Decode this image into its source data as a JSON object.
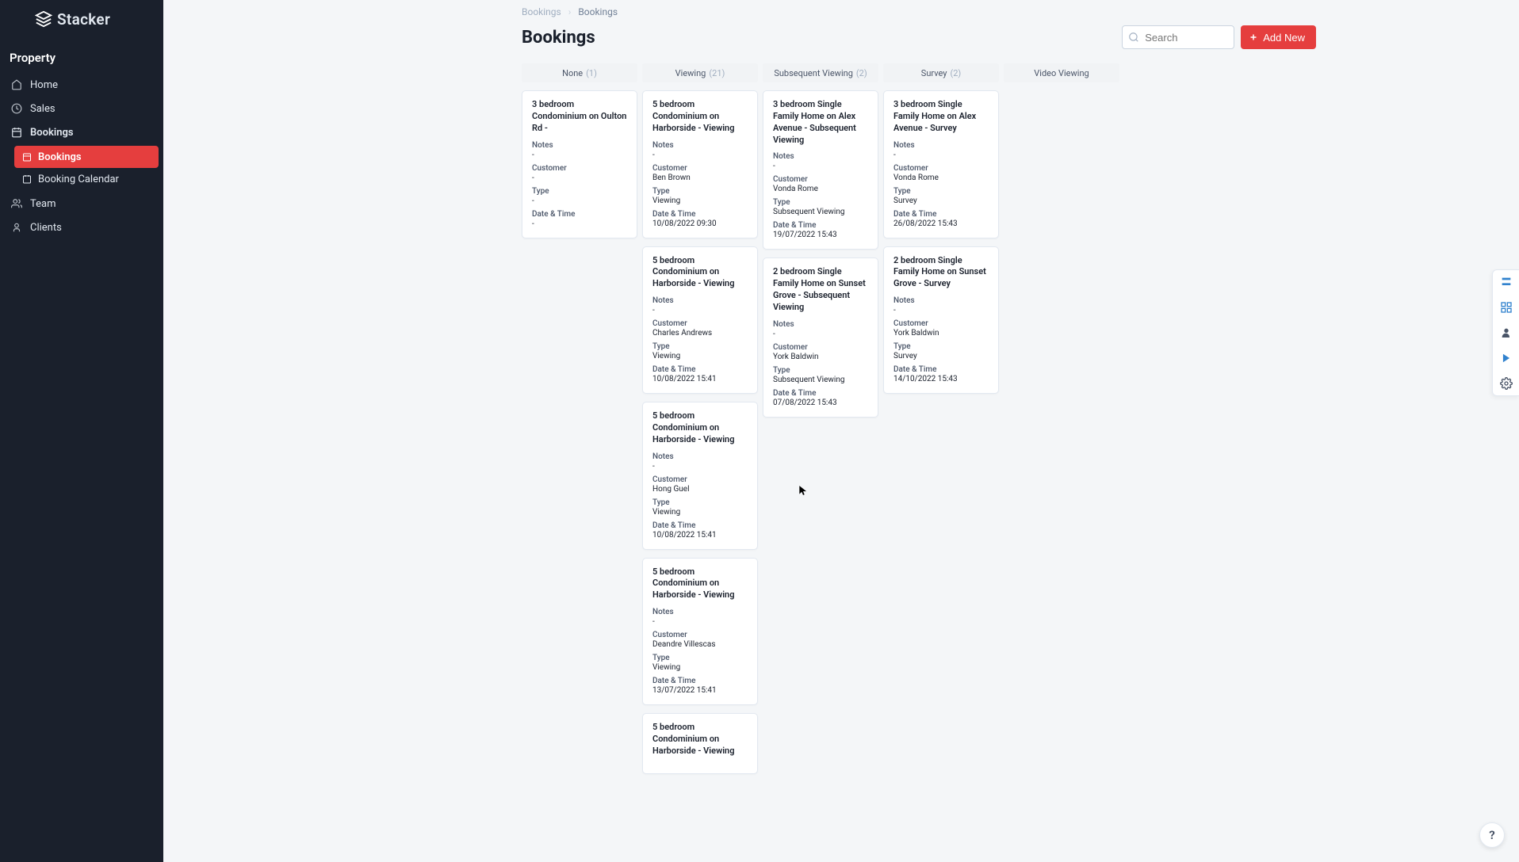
{
  "brand": {
    "name": "Stacker"
  },
  "sidebar": {
    "section": "Property",
    "items": [
      {
        "label": "Home"
      },
      {
        "label": "Sales"
      },
      {
        "label": "Bookings"
      },
      {
        "label": "Team"
      },
      {
        "label": "Clients"
      }
    ],
    "sub": [
      {
        "label": "Bookings"
      },
      {
        "label": "Booking Calendar"
      }
    ]
  },
  "crumbs": {
    "parent": "Bookings",
    "current": "Bookings"
  },
  "page_title": "Bookings",
  "search": {
    "placeholder": "Search"
  },
  "add_btn": {
    "label": "Add New"
  },
  "columns": [
    {
      "name": "None",
      "count": "(1)"
    },
    {
      "name": "Viewing",
      "count": "(21)"
    },
    {
      "name": "Subsequent Viewing",
      "count": "(2)"
    },
    {
      "name": "Survey",
      "count": "(2)"
    },
    {
      "name": "Video Viewing",
      "count": ""
    }
  ],
  "field_labels": {
    "notes": "Notes",
    "customer": "Customer",
    "type": "Type",
    "datetime": "Date & Time"
  },
  "cards": {
    "none": [
      {
        "title": "3 bedroom Condominium on Oulton Rd -",
        "notes": "-",
        "customer": "-",
        "type": "-",
        "datetime": "-"
      }
    ],
    "viewing": [
      {
        "title": "5 bedroom Condominium on Harborside - Viewing",
        "notes": "-",
        "customer": "Ben Brown",
        "type": "Viewing",
        "datetime": "10/08/2022 09:30"
      },
      {
        "title": "5 bedroom Condominium on Harborside - Viewing",
        "notes": "-",
        "customer": "Charles Andrews",
        "type": "Viewing",
        "datetime": "10/08/2022 15:41"
      },
      {
        "title": "5 bedroom Condominium on Harborside - Viewing",
        "notes": "-",
        "customer": "Hong Guel",
        "type": "Viewing",
        "datetime": "10/08/2022 15:41"
      },
      {
        "title": "5 bedroom Condominium on Harborside - Viewing",
        "notes": "-",
        "customer": "Deandre Villescas",
        "type": "Viewing",
        "datetime": "13/07/2022 15:41"
      },
      {
        "title": "5 bedroom Condominium on Harborside - Viewing",
        "notes": "",
        "customer": "",
        "type": "",
        "datetime": ""
      }
    ],
    "subsequent": [
      {
        "title": "3 bedroom Single Family Home on Alex Avenue - Subsequent Viewing",
        "notes": "-",
        "customer": "Vonda Rome",
        "type": "Subsequent Viewing",
        "datetime": "19/07/2022 15:43"
      },
      {
        "title": "2 bedroom Single Family Home on Sunset Grove - Subsequent Viewing",
        "notes": "-",
        "customer": "York Baldwin",
        "type": "Subsequent Viewing",
        "datetime": "07/08/2022 15:43"
      }
    ],
    "survey": [
      {
        "title": "3 bedroom Single Family Home on Alex Avenue - Survey",
        "notes": "-",
        "customer": "Vonda Rome",
        "type": "Survey",
        "datetime": "26/08/2022 15:43"
      },
      {
        "title": "2 bedroom Single Family Home on Sunset Grove - Survey",
        "notes": "-",
        "customer": "York Baldwin",
        "type": "Survey",
        "datetime": "14/10/2022 15:43"
      }
    ]
  },
  "help": "?"
}
